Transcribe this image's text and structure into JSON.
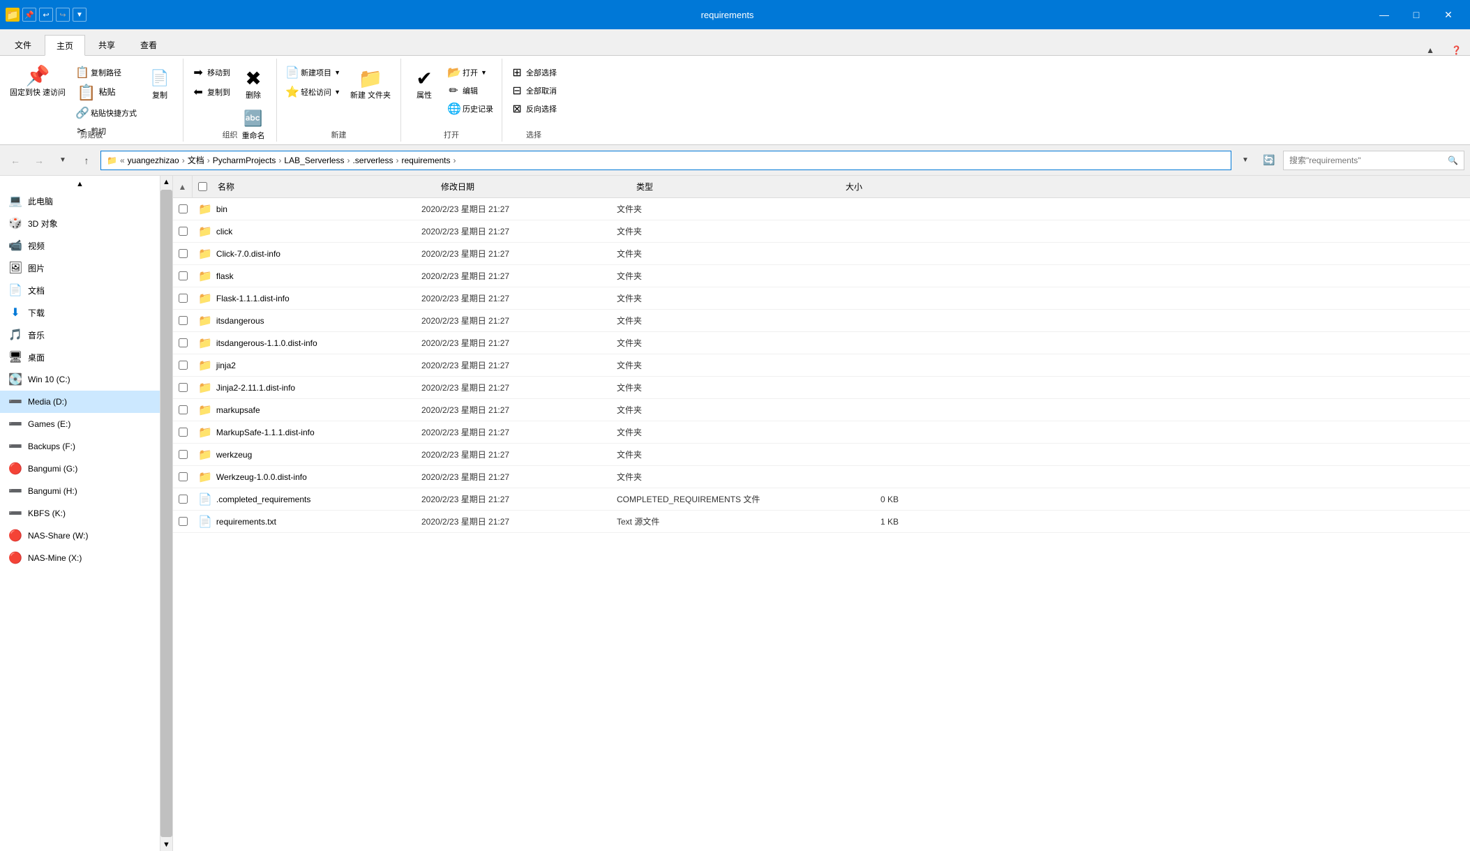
{
  "titleBar": {
    "title": "requirements",
    "minimizeLabel": "—",
    "maximizeLabel": "□",
    "closeLabel": "✕"
  },
  "tabs": {
    "file": "文件",
    "home": "主页",
    "share": "共享",
    "view": "查看"
  },
  "ribbon": {
    "groups": {
      "clipboard": {
        "label": "剪贴板",
        "pinLabel": "固定到快\n速访问",
        "copyLabel": "复制",
        "pasteLabel": "粘贴",
        "pasteShortcutLabel": "粘贴快捷方式",
        "cutLabel": "剪切",
        "copyPathLabel": "复制路径"
      },
      "organize": {
        "label": "组织",
        "moveToLabel": "移动到",
        "copyToLabel": "复制到",
        "deleteLabel": "删除",
        "renameLabel": "重命名"
      },
      "new": {
        "label": "新建",
        "newFolderLabel": "新建\n文件夹",
        "newItemLabel": "新建项目",
        "easyAccessLabel": "轻松访问"
      },
      "open": {
        "label": "打开",
        "propertiesLabel": "属性",
        "openLabel": "打开",
        "editLabel": "编辑",
        "historyLabel": "历史记录"
      },
      "select": {
        "label": "选择",
        "selectAllLabel": "全部选择",
        "selectNoneLabel": "全部取消",
        "invertLabel": "反向选择"
      }
    }
  },
  "addressBar": {
    "breadcrumb": [
      "yuangezhizao",
      "文档",
      "PycharmProjects",
      "LAB_Serverless",
      ".serverless",
      "requirements"
    ],
    "searchPlaceholder": "搜索\"requirements\"",
    "refreshTooltip": "刷新"
  },
  "columnHeaders": {
    "checkbox": "",
    "name": "名称",
    "date": "修改日期",
    "type": "类型",
    "size": "大小"
  },
  "sidebar": {
    "items": [
      {
        "id": "this-pc",
        "icon": "💻",
        "label": "此电脑"
      },
      {
        "id": "3d-objects",
        "icon": "🎲",
        "label": "3D 对象"
      },
      {
        "id": "videos",
        "icon": "🎬",
        "label": "视频"
      },
      {
        "id": "pictures",
        "icon": "🖼",
        "label": "图片"
      },
      {
        "id": "documents",
        "icon": "📄",
        "label": "文档"
      },
      {
        "id": "downloads",
        "icon": "⬇",
        "label": "下载"
      },
      {
        "id": "music",
        "icon": "🎵",
        "label": "音乐"
      },
      {
        "id": "desktop",
        "icon": "🖥",
        "label": "桌面"
      },
      {
        "id": "win10-c",
        "icon": "💽",
        "label": "Win 10 (C:)"
      },
      {
        "id": "media-d",
        "icon": "➖",
        "label": "Media (D:)",
        "selected": true
      },
      {
        "id": "games-e",
        "icon": "➖",
        "label": "Games (E:)"
      },
      {
        "id": "backups-f",
        "icon": "➖",
        "label": "Backups (F:)"
      },
      {
        "id": "bangumi-g",
        "icon": "🔴",
        "label": "Bangumi (G:)"
      },
      {
        "id": "bangumi-h",
        "icon": "➖",
        "label": "Bangumi (H:)"
      },
      {
        "id": "kbfs-k",
        "icon": "➖",
        "label": "KBFS (K:)"
      },
      {
        "id": "nas-share-w",
        "icon": "🔴",
        "label": "NAS-Share (W:)"
      },
      {
        "id": "nas-mine-x",
        "icon": "🔴",
        "label": "NAS-Mine (X:)"
      }
    ]
  },
  "files": [
    {
      "name": "bin",
      "date": "2020/2/23 星期日 21:27",
      "type": "文件夹",
      "size": "",
      "isFolder": true
    },
    {
      "name": "click",
      "date": "2020/2/23 星期日 21:27",
      "type": "文件夹",
      "size": "",
      "isFolder": true
    },
    {
      "name": "Click-7.0.dist-info",
      "date": "2020/2/23 星期日 21:27",
      "type": "文件夹",
      "size": "",
      "isFolder": true
    },
    {
      "name": "flask",
      "date": "2020/2/23 星期日 21:27",
      "type": "文件夹",
      "size": "",
      "isFolder": true
    },
    {
      "name": "Flask-1.1.1.dist-info",
      "date": "2020/2/23 星期日 21:27",
      "type": "文件夹",
      "size": "",
      "isFolder": true
    },
    {
      "name": "itsdangerous",
      "date": "2020/2/23 星期日 21:27",
      "type": "文件夹",
      "size": "",
      "isFolder": true
    },
    {
      "name": "itsdangerous-1.1.0.dist-info",
      "date": "2020/2/23 星期日 21:27",
      "type": "文件夹",
      "size": "",
      "isFolder": true
    },
    {
      "name": "jinja2",
      "date": "2020/2/23 星期日 21:27",
      "type": "文件夹",
      "size": "",
      "isFolder": true
    },
    {
      "name": "Jinja2-2.11.1.dist-info",
      "date": "2020/2/23 星期日 21:27",
      "type": "文件夹",
      "size": "",
      "isFolder": true
    },
    {
      "name": "markupsafe",
      "date": "2020/2/23 星期日 21:27",
      "type": "文件夹",
      "size": "",
      "isFolder": true
    },
    {
      "name": "MarkupSafe-1.1.1.dist-info",
      "date": "2020/2/23 星期日 21:27",
      "type": "文件夹",
      "size": "",
      "isFolder": true
    },
    {
      "name": "werkzeug",
      "date": "2020/2/23 星期日 21:27",
      "type": "文件夹",
      "size": "",
      "isFolder": true
    },
    {
      "name": "Werkzeug-1.0.0.dist-info",
      "date": "2020/2/23 星期日 21:27",
      "type": "文件夹",
      "size": "",
      "isFolder": true
    },
    {
      "name": ".completed_requirements",
      "date": "2020/2/23 星期日 21:27",
      "type": "COMPLETED_REQUIREMENTS 文件",
      "size": "0 KB",
      "isFolder": false
    },
    {
      "name": "requirements.txt",
      "date": "2020/2/23 星期日 21:27",
      "type": "Text 源文件",
      "size": "1 KB",
      "isFolder": false
    }
  ]
}
